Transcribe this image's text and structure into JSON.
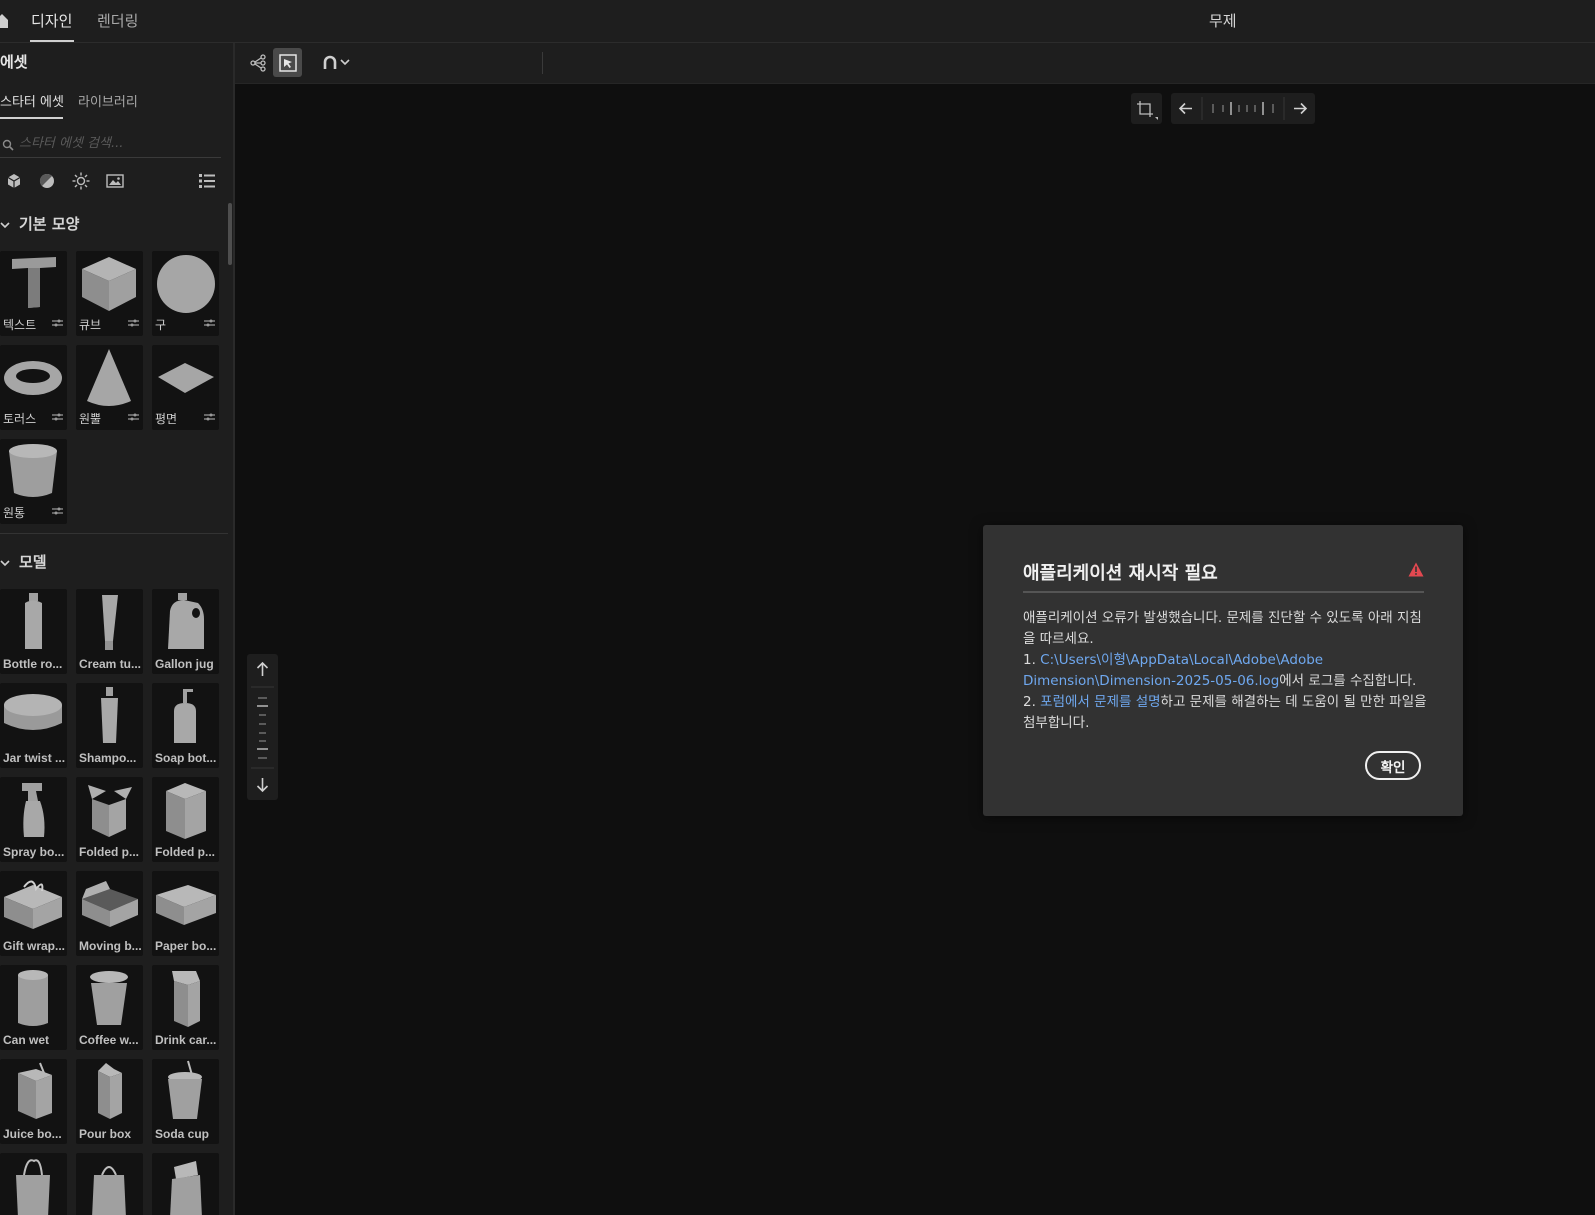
{
  "app": {
    "tabs": [
      {
        "label": "디자인",
        "active": true
      },
      {
        "label": "렌더링",
        "active": false
      }
    ],
    "document_title": "무제"
  },
  "sidebar": {
    "title": "에셋",
    "subtabs": [
      {
        "label": "스타터 에셋",
        "active": true
      },
      {
        "label": "라이브러리",
        "active": false
      }
    ],
    "search": {
      "placeholder": "스타터 에셋 검색...",
      "value": ""
    },
    "filters": [
      "cube-filter-icon",
      "material-filter-icon",
      "light-filter-icon",
      "image-filter-icon"
    ],
    "view_toggle": "list-view-icon",
    "sections": {
      "basic": {
        "title": "기본 모양",
        "items": [
          {
            "label": "텍스트",
            "icon": "text-shape"
          },
          {
            "label": "큐브",
            "icon": "cube-shape"
          },
          {
            "label": "구",
            "icon": "sphere-shape"
          },
          {
            "label": "토러스",
            "icon": "torus-shape"
          },
          {
            "label": "원뿔",
            "icon": "cone-shape"
          },
          {
            "label": "평면",
            "icon": "plane-shape"
          },
          {
            "label": "원통",
            "icon": "cylinder-shape"
          }
        ]
      },
      "models": {
        "title": "모델",
        "items": [
          {
            "label": "Bottle ro..."
          },
          {
            "label": "Cream tu..."
          },
          {
            "label": "Gallon jug"
          },
          {
            "label": "Jar twist ..."
          },
          {
            "label": "Shampo..."
          },
          {
            "label": "Soap bot..."
          },
          {
            "label": "Spray bo..."
          },
          {
            "label": "Folded p..."
          },
          {
            "label": "Folded p..."
          },
          {
            "label": "Gift wrap..."
          },
          {
            "label": "Moving b..."
          },
          {
            "label": "Paper bo..."
          },
          {
            "label": "Can wet"
          },
          {
            "label": "Coffee w..."
          },
          {
            "label": "Drink car..."
          },
          {
            "label": "Juice bo..."
          },
          {
            "label": "Pour box"
          },
          {
            "label": "Soda cup"
          },
          {
            "label": ""
          },
          {
            "label": ""
          },
          {
            "label": ""
          }
        ]
      }
    }
  },
  "toolbar": {
    "tools": [
      "scene-graph-icon",
      "select-tool-icon",
      "magnet-icon",
      "chevron-down-icon"
    ],
    "active_tool": "select-tool-icon"
  },
  "dialog": {
    "title": "애플리케이션 재시작 필요",
    "intro": "애플리케이션 오류가 발생했습니다. 문제를 진단할 수 있도록 아래 지침을 따르세요.",
    "step1_num": "1. ",
    "step1_link": "C:\\Users\\이형\\AppData\\Local\\Adobe\\Adobe Dimension\\Dimension-2025-05-06.log",
    "step1_text": "에서 로그를 수집합니다.",
    "step2_num": "2. ",
    "step2_link": "포럼에서 문제를 설명",
    "step2_text": "하고 문제를 해결하는 데 도움이 될 만한 파일을 첨부합니다.",
    "ok_label": "확인",
    "link_color": "#6fa8ef",
    "warning_color": "#e34850"
  }
}
